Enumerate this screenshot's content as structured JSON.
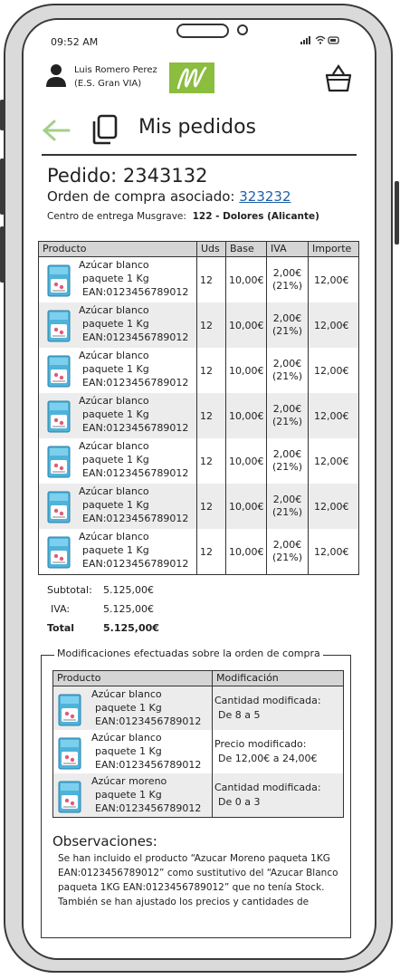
{
  "status_bar": {
    "time": "09:52 AM",
    "icons": "..ıl ᯤ ▭"
  },
  "header": {
    "user_name": "Luis Romero Perez",
    "user_store": "(E.S. Gran VIA)",
    "logo_text": "M"
  },
  "nav": {
    "page_title": "Mis pedidos"
  },
  "order": {
    "title": "Pedido: 2343132",
    "po_label": "Orden de compra asociado: ",
    "po_number": "323232",
    "delivery_label": "Centro de entrega Musgrave:",
    "delivery_value": "122 - Dolores (Alicante)"
  },
  "main_table": {
    "headers": [
      "Producto",
      "Uds",
      "Base",
      "IVA",
      "Importe"
    ],
    "rows": [
      {
        "name_l1": "Azúcar blanco",
        "name_l2": "paquete 1 Kg",
        "ean": "EAN:0123456789012",
        "uds": "12",
        "base": "10,00€",
        "iva_amount": "2,00€",
        "iva_pct": "(21%)",
        "importe": "12,00€"
      },
      {
        "name_l1": "Azúcar blanco",
        "name_l2": "paquete 1 Kg",
        "ean": "EAN:0123456789012",
        "uds": "12",
        "base": "10,00€",
        "iva_amount": "2,00€",
        "iva_pct": "(21%)",
        "importe": "12,00€"
      },
      {
        "name_l1": "Azúcar blanco",
        "name_l2": "paquete 1 Kg",
        "ean": "EAN:0123456789012",
        "uds": "12",
        "base": "10,00€",
        "iva_amount": "2,00€",
        "iva_pct": "(21%)",
        "importe": "12,00€"
      },
      {
        "name_l1": "Azúcar blanco",
        "name_l2": "paquete 1 Kg",
        "ean": "EAN:0123456789012",
        "uds": "12",
        "base": "10,00€",
        "iva_amount": "2,00€",
        "iva_pct": "(21%)",
        "importe": "12,00€"
      },
      {
        "name_l1": "Azúcar blanco",
        "name_l2": "paquete 1 Kg",
        "ean": "EAN:0123456789012",
        "uds": "12",
        "base": "10,00€",
        "iva_amount": "2,00€",
        "iva_pct": "(21%)",
        "importe": "12,00€"
      },
      {
        "name_l1": "Azúcar blanco",
        "name_l2": "paquete 1 Kg",
        "ean": "EAN:0123456789012",
        "uds": "12",
        "base": "10,00€",
        "iva_amount": "2,00€",
        "iva_pct": "(21%)",
        "importe": "12,00€"
      },
      {
        "name_l1": "Azúcar blanco",
        "name_l2": "paquete 1 Kg",
        "ean": "EAN:0123456789012",
        "uds": "12",
        "base": "10,00€",
        "iva_amount": "2,00€",
        "iva_pct": "(21%)",
        "importe": "12,00€"
      }
    ]
  },
  "totals": {
    "subtotal_label": "Subtotal:",
    "subtotal_value": "5.125,00€",
    "iva_label": "IVA:",
    "iva_value": "5.125,00€",
    "total_label": "Total",
    "total_value": "5.125,00€"
  },
  "modifications": {
    "legend": "Modificaciones efectuadas sobre la orden de compra",
    "headers": [
      "Producto",
      "Modificación"
    ],
    "rows": [
      {
        "name_l1": "Azúcar blanco",
        "name_l2": "paquete 1 Kg",
        "ean": "EAN:0123456789012",
        "mod_l1": "Cantidad modificada:",
        "mod_l2": "De 8 a 5"
      },
      {
        "name_l1": "Azúcar blanco",
        "name_l2": "paquete 1 Kg",
        "ean": "EAN:0123456789012",
        "mod_l1": "Precio modificado:",
        "mod_l2": "De 12,00€ a 24,00€"
      },
      {
        "name_l1": "Azúcar moreno",
        "name_l2": "paquete 1 Kg",
        "ean": "EAN:0123456789012",
        "mod_l1": "Cantidad modificada:",
        "mod_l2": "De 0 a 3"
      }
    ]
  },
  "observations": {
    "title": "Observaciones:",
    "text": "Se han incluido el producto “Azucar Moreno paqueta 1KG EAN:0123456789012” como sustitutivo del “Azucar Blanco paqueta 1KG EAN:0123456789012” que no tenía Stock. También se han ajustado los precios y cantidades de"
  },
  "colors": {
    "accent_green": "#8bbd3e",
    "link_blue": "#1f5fa8",
    "header_gray": "#d5d5d5",
    "row_alt": "#ececec"
  }
}
